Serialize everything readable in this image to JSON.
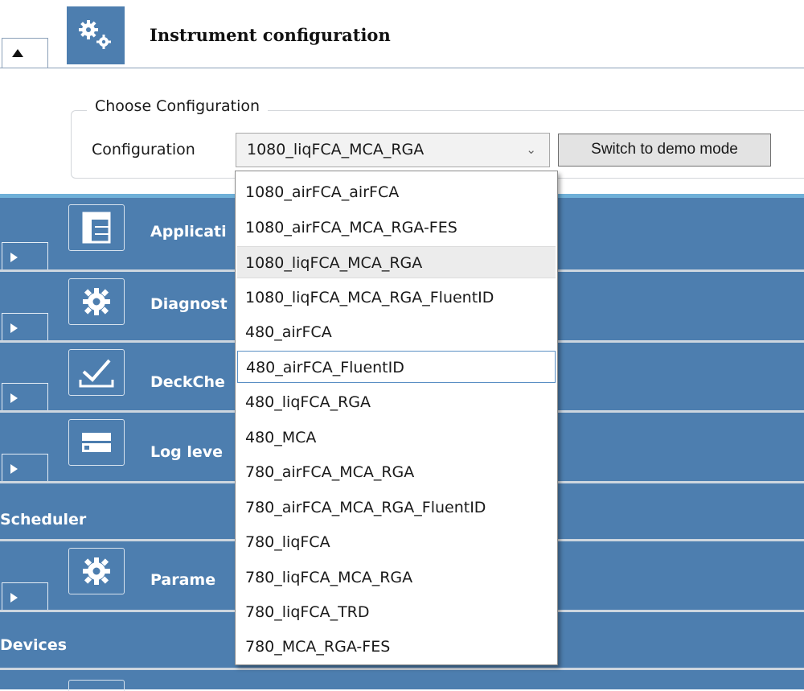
{
  "header": {
    "title": "Instrument configuration",
    "icon": "gears-icon",
    "expander_icon": "triangle-up-icon"
  },
  "choose_configuration": {
    "group_title": "Choose Configuration",
    "configuration_label": "Configuration",
    "selected_value": "1080_liqFCA_MCA_RGA",
    "dropdown_icon": "chevron-down-icon",
    "demo_button_label": "Switch to demo mode"
  },
  "panels": {
    "rows": [
      {
        "label": "Applicati",
        "icon": "application-layout-icon"
      },
      {
        "label": "Diagnost",
        "icon": "gear-icon"
      },
      {
        "label": "DeckChe",
        "icon": "checkmark-icon"
      },
      {
        "label": "Log leve",
        "icon": "log-level-icon"
      }
    ],
    "scheduler_label": "Scheduler",
    "parameters": {
      "label": "Parame",
      "icon": "gear-icon"
    },
    "devices_label": "Devices"
  },
  "dropdown": {
    "options": [
      "1080_airFCA_airFCA",
      "1080_airFCA_MCA_RGA-FES",
      "1080_liqFCA_MCA_RGA",
      "1080_liqFCA_MCA_RGA_FluentID",
      "480_airFCA",
      "480_airFCA_FluentID",
      "480_liqFCA_RGA",
      "480_MCA",
      "780_airFCA_MCA_RGA",
      "780_airFCA_MCA_RGA_FluentID",
      "780_liqFCA",
      "780_liqFCA_MCA_RGA",
      "780_liqFCA_TRD",
      "780_MCA_RGA-FES"
    ],
    "selected_option": "1080_liqFCA_MCA_RGA",
    "focused_option": "480_airFCA_FluentID"
  },
  "colors": {
    "panel_blue": "#4d7eaf",
    "accent_cyan": "#6fb0d8",
    "separator": "#cdd6df"
  }
}
